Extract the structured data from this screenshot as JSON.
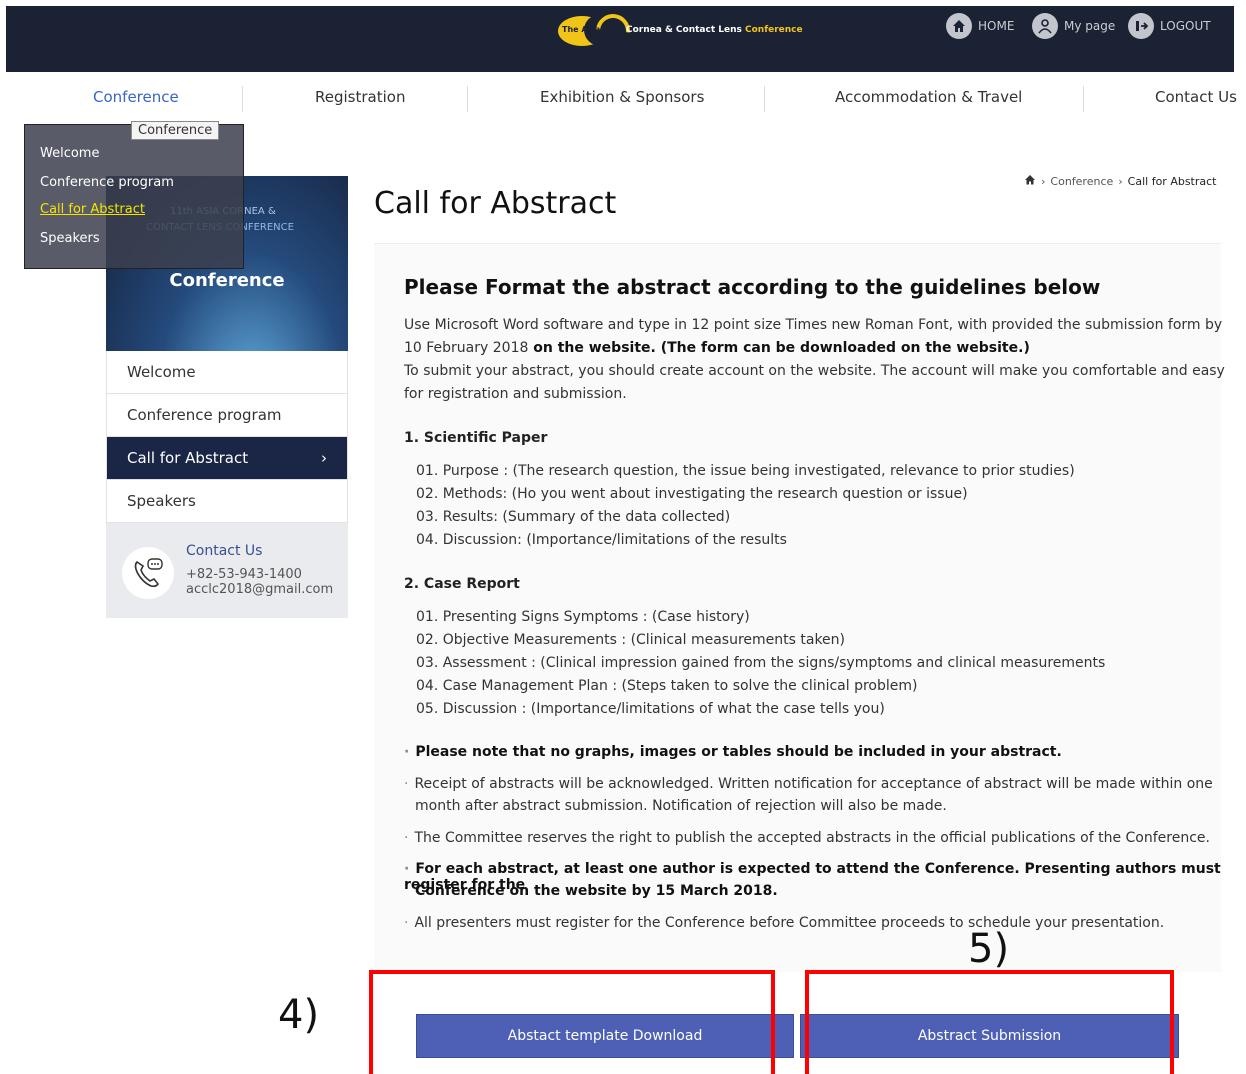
{
  "header": {
    "logo_brand": "The Asia",
    "logo_tagline_main": "Cornea & Contact Lens",
    "logo_tagline_accent": "Conference",
    "utility": [
      {
        "label": "HOME",
        "icon": "home-icon"
      },
      {
        "label": "My page",
        "icon": "user-icon"
      },
      {
        "label": "LOGOUT",
        "icon": "logout-icon"
      }
    ]
  },
  "nav": {
    "items": [
      "Conference",
      "Registration",
      "Exhibition & Sponsors",
      "Accommodation & Travel",
      "Contact Us"
    ],
    "active": "Conference"
  },
  "dropdown": {
    "label": "Conference",
    "items": [
      "Welcome",
      "Conference program",
      "Call for Abstract",
      "Speakers"
    ],
    "selected": "Call for Abstract"
  },
  "sidebar": {
    "banner_line1": "11th ASIA CORNEA &",
    "banner_line2": "CONTACT LENS CONFERENCE",
    "banner_title": "Conference",
    "items": [
      "Welcome",
      "Conference program",
      "Call for Abstract",
      "Speakers"
    ],
    "active": "Call for Abstract",
    "contact": {
      "title": "Contact Us",
      "phone": "+82-53-943-1400",
      "email": "acclc2018@gmail.com"
    }
  },
  "breadcrumb": [
    "Conference",
    "Call for Abstract"
  ],
  "page_title": "Call for Abstract",
  "content": {
    "section_title": "Please Format the abstract according to the guidelines below",
    "intro_line1": "Use Microsoft Word software and type in 12 point size Times new Roman Font, with provided the submission form by",
    "intro_line2_a": "10 February 2018",
    "intro_line2_b": " on the website. (The form can be downloaded on the website.)",
    "intro_line3": "To submit your abstract, you should create account on the website. The account will make you comfortable and easy",
    "intro_line4": "for registration and submission.",
    "paper_heading": "1. Scientific Paper",
    "paper_items": [
      "01.  Purpose : (The research question, the issue being investigated, relevance to prior studies)",
      "02.  Methods: (Ho you went about investigating the research question or issue)",
      "03.  Results: (Summary of the data collected)",
      "04.  Discussion: (Importance/limitations of the results"
    ],
    "case_heading": "2. Case Report",
    "case_items": [
      "01.  Presenting Signs Symptoms : (Case history)",
      "02.  Objective Measurements : (Clinical measurements taken)",
      "03.  Assessment : (Clinical impression gained from the signs/symptoms and clinical measurements",
      "04.  Case Management Plan : (Steps taken to solve the clinical problem)",
      "05.  Discussion : (Importance/limitations of what the case tells you)"
    ],
    "note1": "Please note that no graphs, images or tables should be included in your abstract.",
    "note2_line1": "Receipt of abstracts will be acknowledged. Written notification for acceptance of abstract will be made within one",
    "note2_line2": "month after abstract submission. Notification of rejection will also be made.",
    "note3": "The Committee reserves the right to publish the accepted abstracts in the official publications of the Conference.",
    "note4_line1": "For each abstract, at least one author is expected to attend the Conference. Presenting authors must register for the",
    "note4_line2": "Conference on the website by 15 March 2018.",
    "note5": "All presenters must register for the Conference before Committee proceeds to schedule your presentation."
  },
  "buttons": {
    "download": "Abstact template Download",
    "submit": "Abstract Submission"
  },
  "annotations": {
    "left": "4)",
    "right": "5)"
  },
  "colors": {
    "header_bg": "#1b2233",
    "nav_active": "#3a64c8",
    "sidebar_active_bg": "#1b2546",
    "button_bg": "#4e60b6",
    "highlight": "#ff0000"
  }
}
